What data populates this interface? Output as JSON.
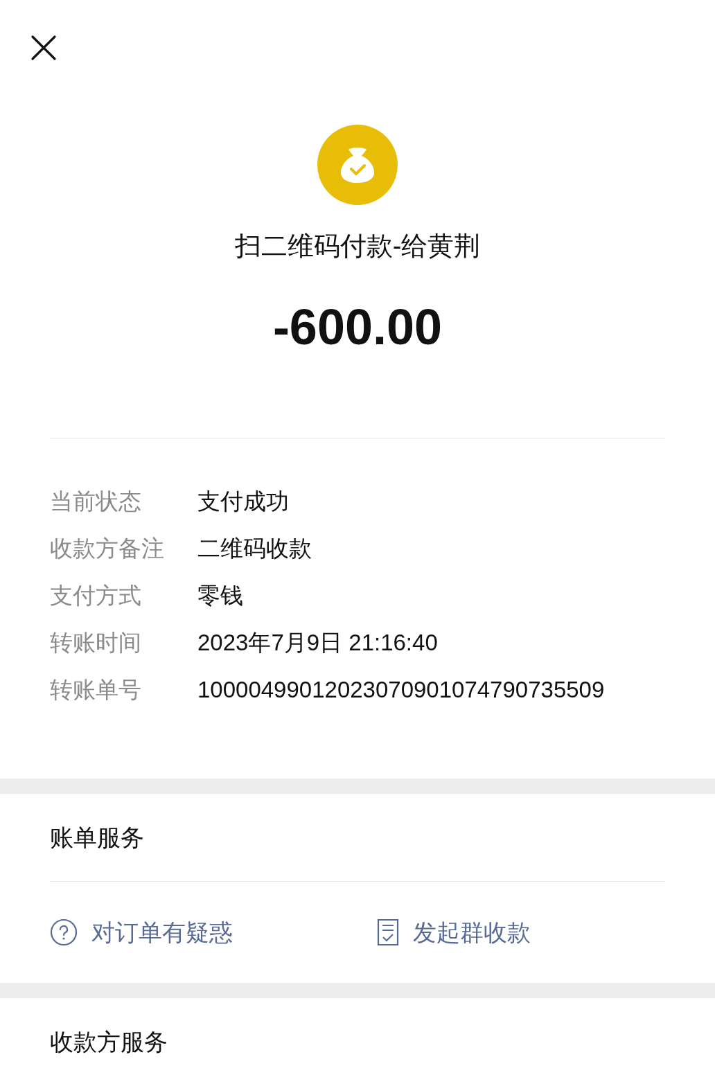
{
  "title": "扫二维码付款-给黄荆",
  "amount": "-600.00",
  "details": [
    {
      "label": "当前状态",
      "value": "支付成功"
    },
    {
      "label": "收款方备注",
      "value": "二维码收款"
    },
    {
      "label": "支付方式",
      "value": "零钱"
    },
    {
      "label": "转账时间",
      "value": "2023年7月9日 21:16:40"
    },
    {
      "label": "转账单号",
      "value": "10000499012023070901074790735509"
    }
  ],
  "bill_services": {
    "title": "账单服务",
    "actions": [
      {
        "kind": "question",
        "label": "对订单有疑惑"
      },
      {
        "kind": "bill",
        "label": "发起群收款"
      }
    ]
  },
  "payee_services": {
    "title": "收款方服务"
  }
}
